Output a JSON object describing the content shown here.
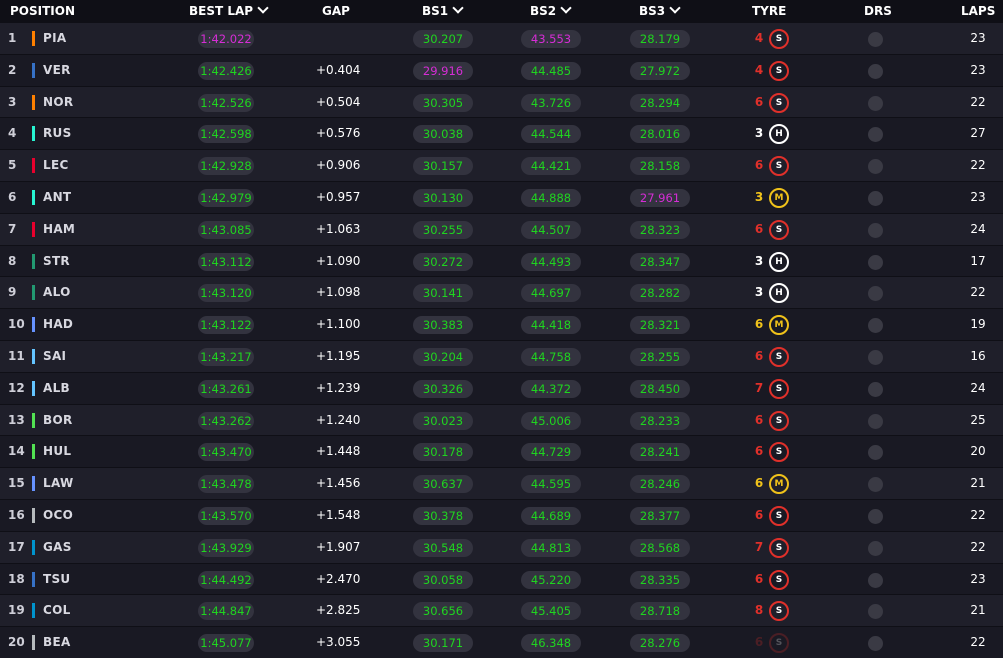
{
  "headers": {
    "position": "POSITION",
    "best_lap": "BEST LAP",
    "gap": "GAP",
    "bs1": "BS1",
    "bs2": "BS2",
    "bs3": "BS3",
    "tyre": "TYRE",
    "drs": "DRS",
    "laps": "LAPS"
  },
  "colors": {
    "personal_best": "#1fd51f",
    "overall_best": "#d62dd6",
    "soft": "#e0302a",
    "medium": "#f0c21a",
    "hard": "#ffffff"
  },
  "rows": [
    {
      "pos": "1",
      "code": "PIA",
      "team_color": "#ff8000",
      "best_lap": "1:42.022",
      "best_lap_purple": true,
      "gap": "",
      "bs1": "30.207",
      "bs1_purple": false,
      "bs2": "43.553",
      "bs2_purple": true,
      "bs3": "28.179",
      "bs3_purple": false,
      "tyre_laps": "4",
      "compound": "S",
      "tyre_icon": "S",
      "laps": "23",
      "dim": false
    },
    {
      "pos": "2",
      "code": "VER",
      "team_color": "#3671c6",
      "best_lap": "1:42.426",
      "best_lap_purple": false,
      "gap": "+0.404",
      "bs1": "29.916",
      "bs1_purple": true,
      "bs2": "44.485",
      "bs2_purple": false,
      "bs3": "27.972",
      "bs3_purple": false,
      "tyre_laps": "4",
      "compound": "S",
      "tyre_icon": "S",
      "laps": "23",
      "dim": false
    },
    {
      "pos": "3",
      "code": "NOR",
      "team_color": "#ff8000",
      "best_lap": "1:42.526",
      "best_lap_purple": false,
      "gap": "+0.504",
      "bs1": "30.305",
      "bs1_purple": false,
      "bs2": "43.726",
      "bs2_purple": false,
      "bs3": "28.294",
      "bs3_purple": false,
      "tyre_laps": "6",
      "compound": "S",
      "tyre_icon": "S",
      "laps": "22",
      "dim": false
    },
    {
      "pos": "4",
      "code": "RUS",
      "team_color": "#27f4d2",
      "best_lap": "1:42.598",
      "best_lap_purple": false,
      "gap": "+0.576",
      "bs1": "30.038",
      "bs1_purple": false,
      "bs2": "44.544",
      "bs2_purple": false,
      "bs3": "28.016",
      "bs3_purple": false,
      "tyre_laps": "3",
      "compound": "H",
      "tyre_icon": "H",
      "laps": "27",
      "dim": false
    },
    {
      "pos": "5",
      "code": "LEC",
      "team_color": "#e8002d",
      "best_lap": "1:42.928",
      "best_lap_purple": false,
      "gap": "+0.906",
      "bs1": "30.157",
      "bs1_purple": false,
      "bs2": "44.421",
      "bs2_purple": false,
      "bs3": "28.158",
      "bs3_purple": false,
      "tyre_laps": "6",
      "compound": "S",
      "tyre_icon": "S",
      "laps": "22",
      "dim": false
    },
    {
      "pos": "6",
      "code": "ANT",
      "team_color": "#27f4d2",
      "best_lap": "1:42.979",
      "best_lap_purple": false,
      "gap": "+0.957",
      "bs1": "30.130",
      "bs1_purple": false,
      "bs2": "44.888",
      "bs2_purple": false,
      "bs3": "27.961",
      "bs3_purple": true,
      "tyre_laps": "3",
      "compound": "M",
      "tyre_icon": "M",
      "laps": "23",
      "dim": false
    },
    {
      "pos": "7",
      "code": "HAM",
      "team_color": "#e8002d",
      "best_lap": "1:43.085",
      "best_lap_purple": false,
      "gap": "+1.063",
      "bs1": "30.255",
      "bs1_purple": false,
      "bs2": "44.507",
      "bs2_purple": false,
      "bs3": "28.323",
      "bs3_purple": false,
      "tyre_laps": "6",
      "compound": "S",
      "tyre_icon": "S",
      "laps": "24",
      "dim": false
    },
    {
      "pos": "8",
      "code": "STR",
      "team_color": "#229971",
      "best_lap": "1:43.112",
      "best_lap_purple": false,
      "gap": "+1.090",
      "bs1": "30.272",
      "bs1_purple": false,
      "bs2": "44.493",
      "bs2_purple": false,
      "bs3": "28.347",
      "bs3_purple": false,
      "tyre_laps": "3",
      "compound": "H",
      "tyre_icon": "H",
      "laps": "17",
      "dim": false
    },
    {
      "pos": "9",
      "code": "ALO",
      "team_color": "#229971",
      "best_lap": "1:43.120",
      "best_lap_purple": false,
      "gap": "+1.098",
      "bs1": "30.141",
      "bs1_purple": false,
      "bs2": "44.697",
      "bs2_purple": false,
      "bs3": "28.282",
      "bs3_purple": false,
      "tyre_laps": "3",
      "compound": "H",
      "tyre_icon": "H",
      "laps": "22",
      "dim": false
    },
    {
      "pos": "10",
      "code": "HAD",
      "team_color": "#6692ff",
      "best_lap": "1:43.122",
      "best_lap_purple": false,
      "gap": "+1.100",
      "bs1": "30.383",
      "bs1_purple": false,
      "bs2": "44.418",
      "bs2_purple": false,
      "bs3": "28.321",
      "bs3_purple": false,
      "tyre_laps": "6",
      "compound": "M",
      "tyre_icon": "M",
      "laps": "19",
      "dim": false
    },
    {
      "pos": "11",
      "code": "SAI",
      "team_color": "#64c4ff",
      "best_lap": "1:43.217",
      "best_lap_purple": false,
      "gap": "+1.195",
      "bs1": "30.204",
      "bs1_purple": false,
      "bs2": "44.758",
      "bs2_purple": false,
      "bs3": "28.255",
      "bs3_purple": false,
      "tyre_laps": "6",
      "compound": "S",
      "tyre_icon": "S",
      "laps": "16",
      "dim": false
    },
    {
      "pos": "12",
      "code": "ALB",
      "team_color": "#64c4ff",
      "best_lap": "1:43.261",
      "best_lap_purple": false,
      "gap": "+1.239",
      "bs1": "30.326",
      "bs1_purple": false,
      "bs2": "44.372",
      "bs2_purple": false,
      "bs3": "28.450",
      "bs3_purple": false,
      "tyre_laps": "7",
      "compound": "S",
      "tyre_icon": "S",
      "laps": "24",
      "dim": false
    },
    {
      "pos": "13",
      "code": "BOR",
      "team_color": "#52e252",
      "best_lap": "1:43.262",
      "best_lap_purple": false,
      "gap": "+1.240",
      "bs1": "30.023",
      "bs1_purple": false,
      "bs2": "45.006",
      "bs2_purple": false,
      "bs3": "28.233",
      "bs3_purple": false,
      "tyre_laps": "6",
      "compound": "S",
      "tyre_icon": "S",
      "laps": "25",
      "dim": false
    },
    {
      "pos": "14",
      "code": "HUL",
      "team_color": "#52e252",
      "best_lap": "1:43.470",
      "best_lap_purple": false,
      "gap": "+1.448",
      "bs1": "30.178",
      "bs1_purple": false,
      "bs2": "44.729",
      "bs2_purple": false,
      "bs3": "28.241",
      "bs3_purple": false,
      "tyre_laps": "6",
      "compound": "S",
      "tyre_icon": "S",
      "laps": "20",
      "dim": false
    },
    {
      "pos": "15",
      "code": "LAW",
      "team_color": "#6692ff",
      "best_lap": "1:43.478",
      "best_lap_purple": false,
      "gap": "+1.456",
      "bs1": "30.637",
      "bs1_purple": false,
      "bs2": "44.595",
      "bs2_purple": false,
      "bs3": "28.246",
      "bs3_purple": false,
      "tyre_laps": "6",
      "compound": "M",
      "tyre_icon": "M",
      "laps": "21",
      "dim": false
    },
    {
      "pos": "16",
      "code": "OCO",
      "team_color": "#b6babd",
      "best_lap": "1:43.570",
      "best_lap_purple": false,
      "gap": "+1.548",
      "bs1": "30.378",
      "bs1_purple": false,
      "bs2": "44.689",
      "bs2_purple": false,
      "bs3": "28.377",
      "bs3_purple": false,
      "tyre_laps": "6",
      "compound": "S",
      "tyre_icon": "S",
      "laps": "22",
      "dim": false
    },
    {
      "pos": "17",
      "code": "GAS",
      "team_color": "#0093cc",
      "best_lap": "1:43.929",
      "best_lap_purple": false,
      "gap": "+1.907",
      "bs1": "30.548",
      "bs1_purple": false,
      "bs2": "44.813",
      "bs2_purple": false,
      "bs3": "28.568",
      "bs3_purple": false,
      "tyre_laps": "7",
      "compound": "S",
      "tyre_icon": "S",
      "laps": "22",
      "dim": false
    },
    {
      "pos": "18",
      "code": "TSU",
      "team_color": "#3671c6",
      "best_lap": "1:44.492",
      "best_lap_purple": false,
      "gap": "+2.470",
      "bs1": "30.058",
      "bs1_purple": false,
      "bs2": "45.220",
      "bs2_purple": false,
      "bs3": "28.335",
      "bs3_purple": false,
      "tyre_laps": "6",
      "compound": "S",
      "tyre_icon": "S",
      "laps": "23",
      "dim": false
    },
    {
      "pos": "19",
      "code": "COL",
      "team_color": "#0093cc",
      "best_lap": "1:44.847",
      "best_lap_purple": false,
      "gap": "+2.825",
      "bs1": "30.656",
      "bs1_purple": false,
      "bs2": "45.405",
      "bs2_purple": false,
      "bs3": "28.718",
      "bs3_purple": false,
      "tyre_laps": "8",
      "compound": "S",
      "tyre_icon": "S",
      "laps": "21",
      "dim": false
    },
    {
      "pos": "20",
      "code": "BEA",
      "team_color": "#b6babd",
      "best_lap": "1:45.077",
      "best_lap_purple": false,
      "gap": "+3.055",
      "bs1": "30.171",
      "bs1_purple": false,
      "bs2": "46.348",
      "bs2_purple": false,
      "bs3": "28.276",
      "bs3_purple": false,
      "tyre_laps": "6",
      "compound": "S",
      "tyre_icon": "S",
      "laps": "22",
      "dim": true
    }
  ]
}
